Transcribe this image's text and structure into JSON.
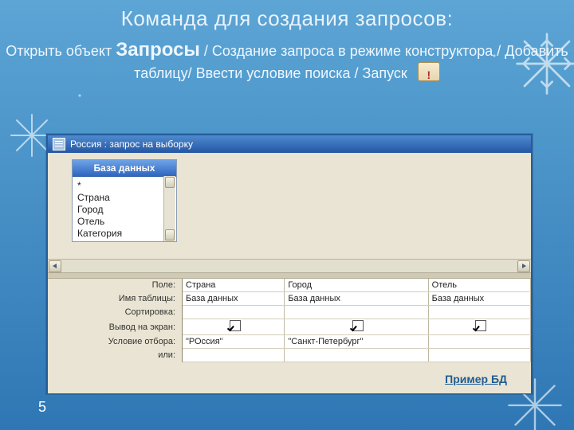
{
  "slide": {
    "title": "Команда для создания  запросов:",
    "instruction_parts": {
      "p1": "Открыть объект ",
      "bold": "Запросы",
      "p2": " / Создание запроса в режиме конструктора / Добавить таблицу/ Ввести условие поиска / Запуск"
    },
    "page_number": "5"
  },
  "window": {
    "title": "Россия : запрос на выборку",
    "fieldlist_title": "База данных",
    "fieldlist_items": [
      "*",
      "Страна",
      "Город",
      "Отель",
      "Категория"
    ],
    "grid_labels": {
      "field": "Поле:",
      "table": "Имя таблицы:",
      "sort": "Сортировка:",
      "show": "Вывод на экран:",
      "criteria": "Условие отбора:",
      "or": "или:"
    },
    "columns": [
      {
        "field": "Страна",
        "table": "База данных",
        "show": true,
        "criteria": "\"РОссия\""
      },
      {
        "field": "Город",
        "table": "База данных",
        "show": true,
        "criteria": "\"Санкт-Петербург\""
      },
      {
        "field": "Отель",
        "table": "База данных",
        "show": true,
        "criteria": ""
      }
    ]
  },
  "link": {
    "label": "Пример БД"
  }
}
